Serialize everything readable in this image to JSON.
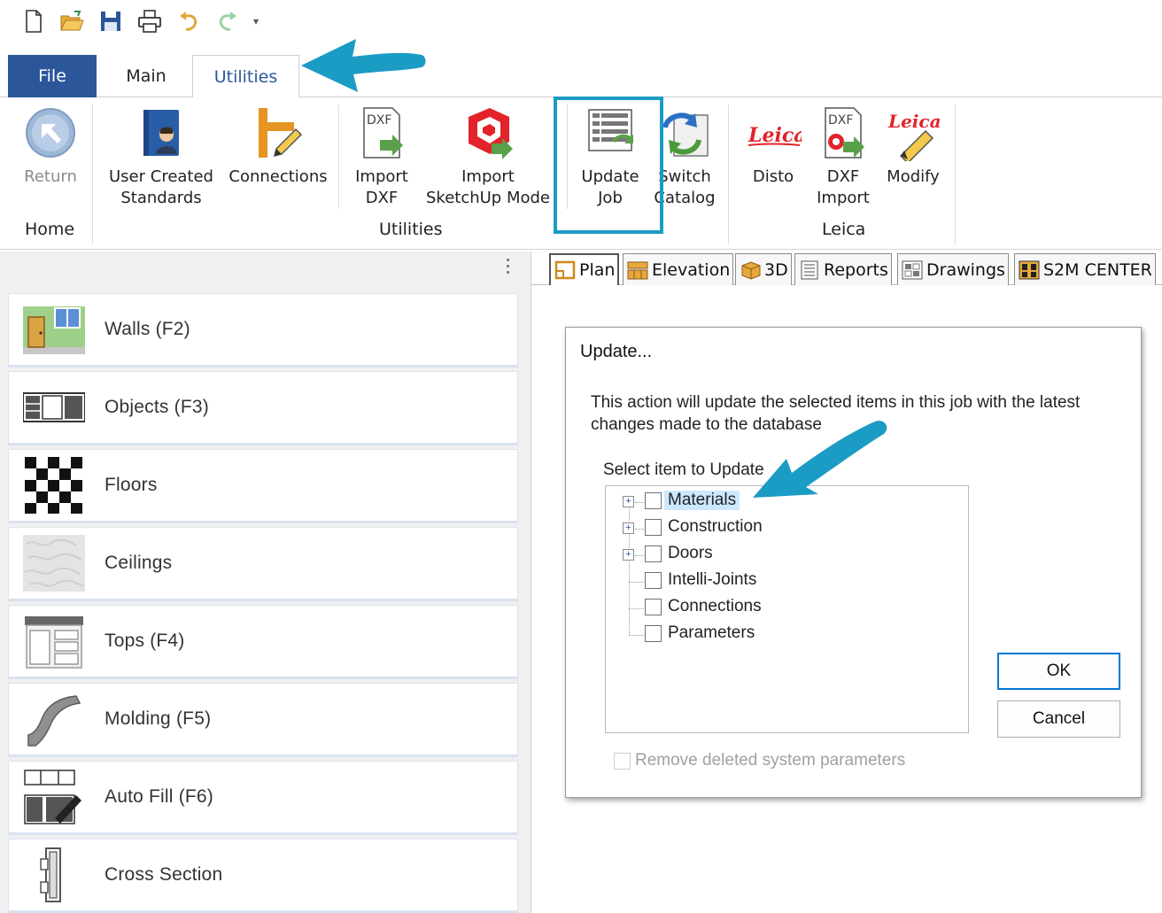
{
  "quick_access": {
    "icons": [
      "new-file-icon",
      "open-folder-icon",
      "save-icon",
      "print-icon",
      "undo-icon",
      "redo-icon"
    ],
    "more": "▾"
  },
  "tabs": {
    "file": "File",
    "main": "Main",
    "utilities": "Utilities"
  },
  "ribbon": {
    "return_label": "Return",
    "user_standards_l1": "User Created",
    "user_standards_l2": "Standards",
    "connections_label": "Connections",
    "import_dxf_l1": "Import",
    "import_dxf_l2": "DXF",
    "import_sketchup_l1": "Import",
    "import_sketchup_l2": "SketchUp Mode",
    "update_job_l1": "Update",
    "update_job_l2": "Job",
    "switch_catalog_l1": "Switch",
    "switch_catalog_l2": "Catalog",
    "disto_label": "Disto",
    "dxf_import_l1": "DXF",
    "dxf_import_l2": "Import",
    "modify_label": "Modify",
    "dxf_badge": "DXF",
    "leica_brand": "Leica",
    "groups": {
      "home": "Home",
      "utilities": "Utilities",
      "leica": "Leica"
    }
  },
  "left_panel": {
    "items": [
      {
        "label": "Walls (F2)"
      },
      {
        "label": "Objects (F3)"
      },
      {
        "label": "Floors"
      },
      {
        "label": "Ceilings"
      },
      {
        "label": "Tops (F4)"
      },
      {
        "label": "Molding (F5)"
      },
      {
        "label": "Auto Fill (F6)"
      },
      {
        "label": "Cross Section"
      }
    ]
  },
  "doc_tabs": [
    {
      "label": "Plan"
    },
    {
      "label": "Elevation"
    },
    {
      "label": "3D"
    },
    {
      "label": "Reports"
    },
    {
      "label": "Drawings"
    },
    {
      "label": "S2M CENTER"
    }
  ],
  "dialog": {
    "title": "Update...",
    "description": "This action will update the selected items in this job with the latest changes made to the database",
    "select_label": "Select item to Update",
    "tree_items": [
      {
        "label": "Materials",
        "expandable": true,
        "selected": true
      },
      {
        "label": "Construction",
        "expandable": true
      },
      {
        "label": "Doors",
        "expandable": true
      },
      {
        "label": "Intelli-Joints",
        "expandable": false
      },
      {
        "label": "Connections",
        "expandable": false
      },
      {
        "label": "Parameters",
        "expandable": false
      }
    ],
    "ok_label": "OK",
    "cancel_label": "Cancel",
    "remove_deleted_label": "Remove deleted system parameters"
  },
  "colors": {
    "accent": "#2b579a",
    "callout": "#1b9cc4"
  }
}
